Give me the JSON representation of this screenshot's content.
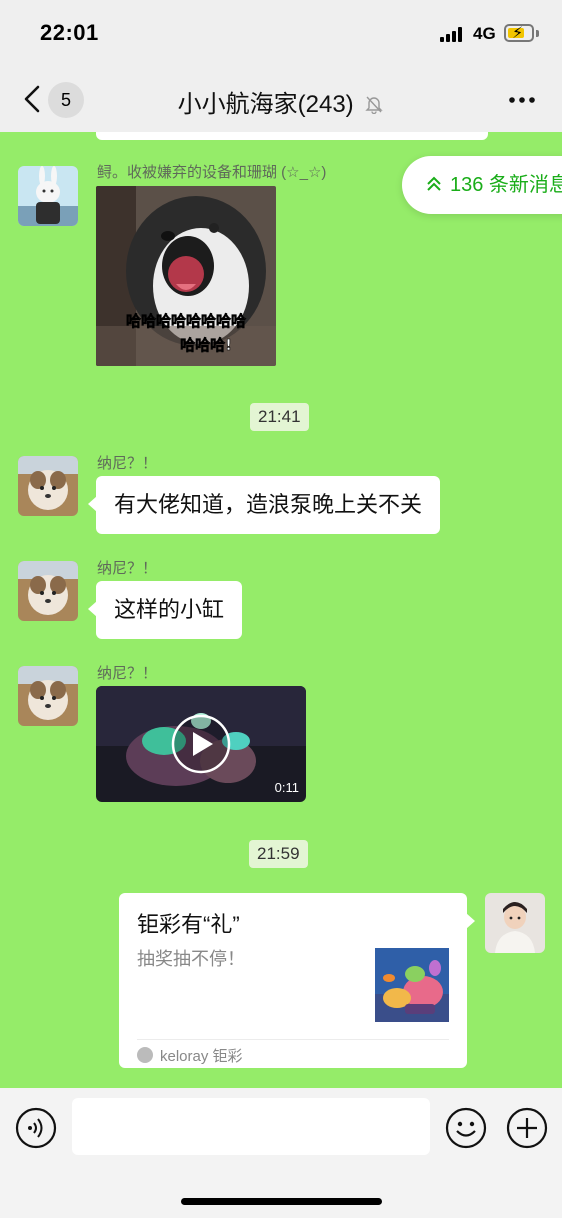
{
  "status_bar": {
    "time": "22:01",
    "network": "4G"
  },
  "nav": {
    "back_count": "5",
    "title": "小小航海家(243)"
  },
  "new_messages": {
    "label": "136 条新消息"
  },
  "messages": [
    {
      "sender": "鲟。收被嫌弃的设备和珊瑚 (☆_☆)",
      "sticker_text_1": "哈哈哈哈哈哈哈哈",
      "sticker_text_2": "哈哈哈!"
    },
    {
      "time": "21:41"
    },
    {
      "sender": "纳尼？！",
      "text": "有大佬知道，造浪泵晚上关不关"
    },
    {
      "sender": "纳尼？！",
      "text": "这样的小缸"
    },
    {
      "sender": "纳尼？！",
      "video_duration": "0:11"
    },
    {
      "time": "21:59"
    }
  ],
  "link_card": {
    "title": "钜彩有“礼”",
    "description": "抽奖抽不停！",
    "source": "keloray 钜彩"
  },
  "input": {
    "placeholder": ""
  },
  "colors": {
    "chat_bg": "#95ec69",
    "accent": "#1aad19",
    "bar_bg": "#efefef"
  }
}
